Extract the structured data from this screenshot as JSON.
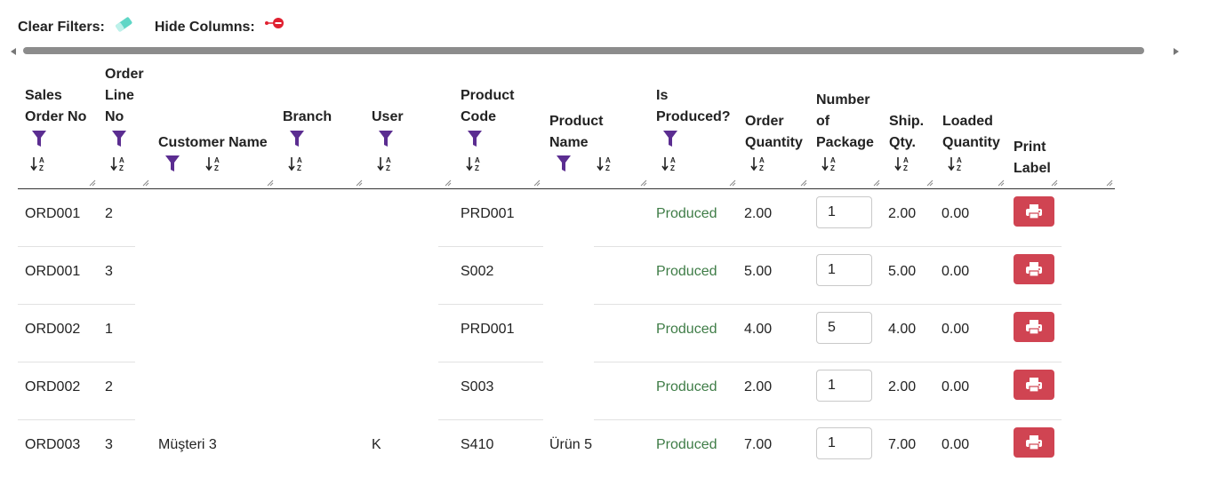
{
  "toolbar": {
    "clear_filters": "Clear Filters:",
    "hide_columns": "Hide Columns:"
  },
  "columns": [
    {
      "lines": [
        "Sales",
        "Order No"
      ]
    },
    {
      "lines": [
        "Order",
        "Line",
        "No"
      ]
    },
    {
      "lines": [
        "Customer Name"
      ]
    },
    {
      "lines": [
        "Branch"
      ]
    },
    {
      "lines": [
        "User"
      ]
    },
    {
      "lines": [
        "Product",
        "Code"
      ]
    },
    {
      "lines": [
        "Product",
        "Name"
      ]
    },
    {
      "lines": [
        "Is",
        "Produced?"
      ]
    },
    {
      "lines": [
        "Order",
        "Quantity"
      ]
    },
    {
      "lines": [
        "Number",
        "of",
        "Package"
      ]
    },
    {
      "lines": [
        "Ship.",
        "Qty."
      ]
    },
    {
      "lines": [
        "Loaded",
        "Quantity"
      ]
    },
    {
      "lines": [
        "Print",
        "Label"
      ]
    }
  ],
  "rows": [
    {
      "order_no": "ORD001",
      "line_no": "2",
      "customer": "",
      "branch": "",
      "user": "",
      "product_code": "PRD001",
      "product_name": "",
      "produced": "Produced",
      "order_qty": "2.00",
      "packages": "1",
      "ship_qty": "2.00",
      "loaded_qty": "0.00"
    },
    {
      "order_no": "ORD001",
      "line_no": "3",
      "customer": "",
      "branch": "",
      "user": "",
      "product_code": "S002",
      "product_name": "",
      "produced": "Produced",
      "order_qty": "5.00",
      "packages": "1",
      "ship_qty": "5.00",
      "loaded_qty": "0.00"
    },
    {
      "order_no": "ORD002",
      "line_no": "1",
      "customer": "",
      "branch": "",
      "user": "",
      "product_code": "PRD001",
      "product_name": "",
      "produced": "Produced",
      "order_qty": "4.00",
      "packages": "5",
      "ship_qty": "4.00",
      "loaded_qty": "0.00"
    },
    {
      "order_no": "ORD002",
      "line_no": "2",
      "customer": "",
      "branch": "",
      "user": "",
      "product_code": "S003",
      "product_name": "",
      "produced": "Produced",
      "order_qty": "2.00",
      "packages": "1",
      "ship_qty": "2.00",
      "loaded_qty": "0.00"
    },
    {
      "order_no": "ORD003",
      "line_no": "3",
      "customer": "Müşteri 3",
      "branch": "",
      "user": "K",
      "product_code": "S410",
      "product_name": "Ürün 5",
      "produced": "Produced",
      "order_qty": "7.00",
      "packages": "1",
      "ship_qty": "7.00",
      "loaded_qty": "0.00"
    }
  ],
  "colors": {
    "filter_icon": "#5b2d91",
    "produced_text": "#3e7c46",
    "print_button": "#d04452",
    "eraser_icon": "#5fd6c6",
    "hide_icon": "#e02030"
  },
  "icons": {
    "clear_filters": "eraser-icon",
    "hide_columns": "hide-column-icon",
    "filter": "filter-funnel-icon",
    "sort": "sort-az-icon",
    "print": "printer-icon"
  }
}
